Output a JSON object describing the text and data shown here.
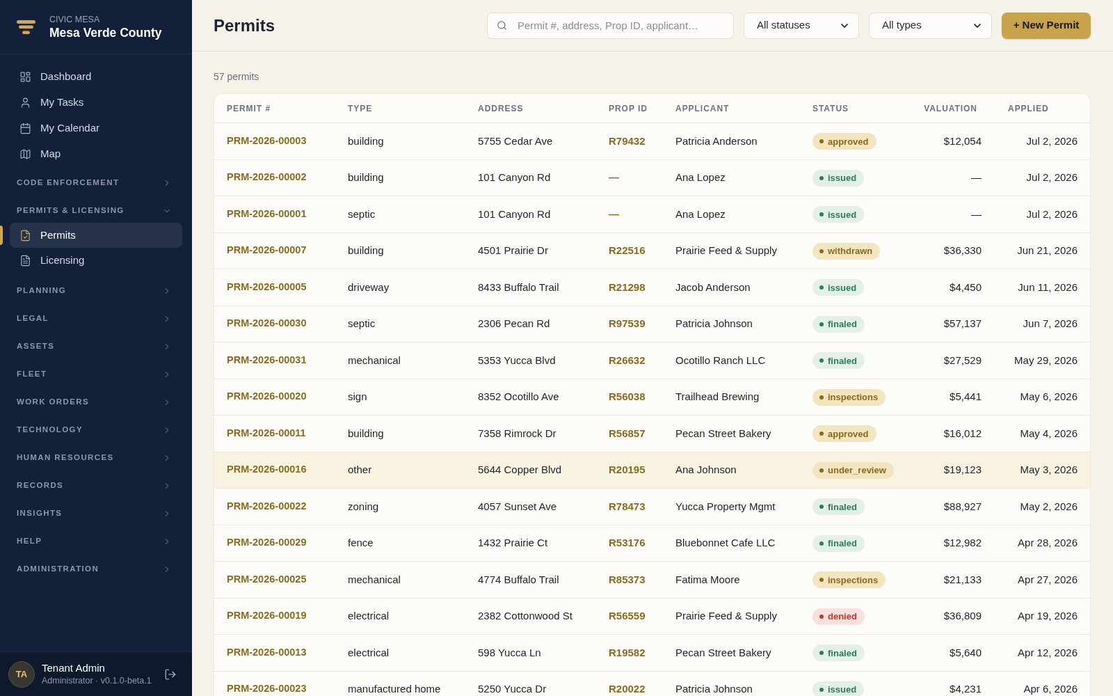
{
  "brand": {
    "eyebrow": "CIVIC MESA",
    "name": "Mesa Verde County"
  },
  "nav": [
    {
      "label": "Dashboard",
      "selected": false
    },
    {
      "label": "My Tasks",
      "selected": false
    },
    {
      "label": "My Calendar",
      "selected": false
    },
    {
      "label": "Map",
      "selected": false
    }
  ],
  "sections": [
    {
      "label": "CODE ENFORCEMENT",
      "expanded": false
    },
    {
      "label": "PERMITS & LICENSING",
      "expanded": true,
      "items": [
        {
          "label": "Permits",
          "selected": true
        },
        {
          "label": "Licensing",
          "selected": false
        }
      ]
    },
    {
      "label": "PLANNING",
      "expanded": false
    },
    {
      "label": "LEGAL",
      "expanded": false
    },
    {
      "label": "ASSETS",
      "expanded": false
    },
    {
      "label": "FLEET",
      "expanded": false
    },
    {
      "label": "WORK ORDERS",
      "expanded": false
    },
    {
      "label": "TECHNOLOGY",
      "expanded": false
    },
    {
      "label": "HUMAN RESOURCES",
      "expanded": false
    },
    {
      "label": "RECORDS",
      "expanded": false
    },
    {
      "label": "INSIGHTS",
      "expanded": false
    },
    {
      "label": "HELP",
      "expanded": false
    },
    {
      "label": "ADMINISTRATION",
      "expanded": false
    }
  ],
  "user": {
    "initials": "TA",
    "name": "Tenant Admin",
    "role": "Administrator · v0.1.0-beta.1"
  },
  "header": {
    "title": "Permits",
    "search": {
      "placeholder": "Permit #, address, Prop ID, applicant…"
    },
    "filters": [
      {
        "value": "All statuses"
      },
      {
        "value": "All types"
      }
    ],
    "new_button": "+ New Permit"
  },
  "count": "57 permits",
  "table": {
    "columns": [
      "PERMIT #",
      "TYPE",
      "ADDRESS",
      "PROP ID",
      "APPLICANT",
      "STATUS",
      "VALUATION",
      "APPLIED"
    ],
    "rows": [
      {
        "permit": "PRM-2026-00003",
        "type": "building",
        "address": "5755 Cedar Ave",
        "prop_id": "R79432",
        "applicant": "Patricia Anderson",
        "status": {
          "label": "approved",
          "color": "#8a6a1a"
        },
        "valuation": "$12,054",
        "applied": "Jul 2, 2026",
        "selected": false
      },
      {
        "permit": "PRM-2026-00002",
        "type": "building",
        "address": "101 Canyon Rd",
        "prop_id": "—",
        "applicant": "Ana Lopez",
        "status": {
          "label": "issued",
          "color": "#2f7d5a"
        },
        "valuation": "—",
        "applied": "Jul 2, 2026",
        "selected": false
      },
      {
        "permit": "PRM-2026-00001",
        "type": "septic",
        "address": "101 Canyon Rd",
        "prop_id": "—",
        "applicant": "Ana Lopez",
        "status": {
          "label": "issued",
          "color": "#2f7d5a"
        },
        "valuation": "—",
        "applied": "Jul 2, 2026",
        "selected": false
      },
      {
        "permit": "PRM-2026-00007",
        "type": "building",
        "address": "4501 Prairie Dr",
        "prop_id": "R22516",
        "applicant": "Prairie Feed & Supply",
        "status": {
          "label": "withdrawn",
          "color": "#8a6a1a"
        },
        "valuation": "$36,330",
        "applied": "Jun 21, 2026",
        "selected": false
      },
      {
        "permit": "PRM-2026-00005",
        "type": "driveway",
        "address": "8433 Buffalo Trail",
        "prop_id": "R21298",
        "applicant": "Jacob Anderson",
        "status": {
          "label": "issued",
          "color": "#2f7d5a"
        },
        "valuation": "$4,450",
        "applied": "Jun 11, 2026",
        "selected": false
      },
      {
        "permit": "PRM-2026-00030",
        "type": "septic",
        "address": "2306 Pecan Rd",
        "prop_id": "R97539",
        "applicant": "Patricia Johnson",
        "status": {
          "label": "finaled",
          "color": "#2f7d5a"
        },
        "valuation": "$57,137",
        "applied": "Jun 7, 2026",
        "selected": false
      },
      {
        "permit": "PRM-2026-00031",
        "type": "mechanical",
        "address": "5353 Yucca Blvd",
        "prop_id": "R26632",
        "applicant": "Ocotillo Ranch LLC",
        "status": {
          "label": "finaled",
          "color": "#2f7d5a"
        },
        "valuation": "$27,529",
        "applied": "May 29, 2026",
        "selected": false
      },
      {
        "permit": "PRM-2026-00020",
        "type": "sign",
        "address": "8352 Ocotillo Ave",
        "prop_id": "R56038",
        "applicant": "Trailhead Brewing",
        "status": {
          "label": "inspections",
          "color": "#8a6a1a"
        },
        "valuation": "$5,441",
        "applied": "May 6, 2026",
        "selected": false
      },
      {
        "permit": "PRM-2026-00011",
        "type": "building",
        "address": "7358 Rimrock Dr",
        "prop_id": "R56857",
        "applicant": "Pecan Street Bakery",
        "status": {
          "label": "approved",
          "color": "#8a6a1a"
        },
        "valuation": "$16,012",
        "applied": "May 4, 2026",
        "selected": false
      },
      {
        "permit": "PRM-2026-00016",
        "type": "other",
        "address": "5644 Copper Blvd",
        "prop_id": "R20195",
        "applicant": "Ana Johnson",
        "status": {
          "label": "under_review",
          "color": "#8a6a1a"
        },
        "valuation": "$19,123",
        "applied": "May 3, 2026",
        "selected": true
      },
      {
        "permit": "PRM-2026-00022",
        "type": "zoning",
        "address": "4057 Sunset Ave",
        "prop_id": "R78473",
        "applicant": "Yucca Property Mgmt",
        "status": {
          "label": "finaled",
          "color": "#2f7d5a"
        },
        "valuation": "$88,927",
        "applied": "May 2, 2026",
        "selected": false
      },
      {
        "permit": "PRM-2026-00029",
        "type": "fence",
        "address": "1432 Prairie Ct",
        "prop_id": "R53176",
        "applicant": "Bluebonnet Cafe LLC",
        "status": {
          "label": "finaled",
          "color": "#2f7d5a"
        },
        "valuation": "$12,982",
        "applied": "Apr 28, 2026",
        "selected": false
      },
      {
        "permit": "PRM-2026-00025",
        "type": "mechanical",
        "address": "4774 Buffalo Trail",
        "prop_id": "R85373",
        "applicant": "Fatima Moore",
        "status": {
          "label": "inspections",
          "color": "#8a6a1a"
        },
        "valuation": "$21,133",
        "applied": "Apr 27, 2026",
        "selected": false
      },
      {
        "permit": "PRM-2026-00019",
        "type": "electrical",
        "address": "2382 Cottonwood St",
        "prop_id": "R56559",
        "applicant": "Prairie Feed & Supply",
        "status": {
          "label": "denied",
          "color": "#c0392b"
        },
        "valuation": "$36,809",
        "applied": "Apr 19, 2026",
        "selected": false
      },
      {
        "permit": "PRM-2026-00013",
        "type": "electrical",
        "address": "598 Yucca Ln",
        "prop_id": "R19582",
        "applicant": "Pecan Street Bakery",
        "status": {
          "label": "finaled",
          "color": "#2f7d5a"
        },
        "valuation": "$5,640",
        "applied": "Apr 12, 2026",
        "selected": false
      },
      {
        "permit": "PRM-2026-00023",
        "type": "manufactured home",
        "address": "5250 Yucca Dr",
        "prop_id": "R20022",
        "applicant": "Patricia Johnson",
        "status": {
          "label": "issued",
          "color": "#2f7d5a"
        },
        "valuation": "$4,231",
        "applied": "Apr 6, 2026",
        "selected": false
      }
    ]
  }
}
